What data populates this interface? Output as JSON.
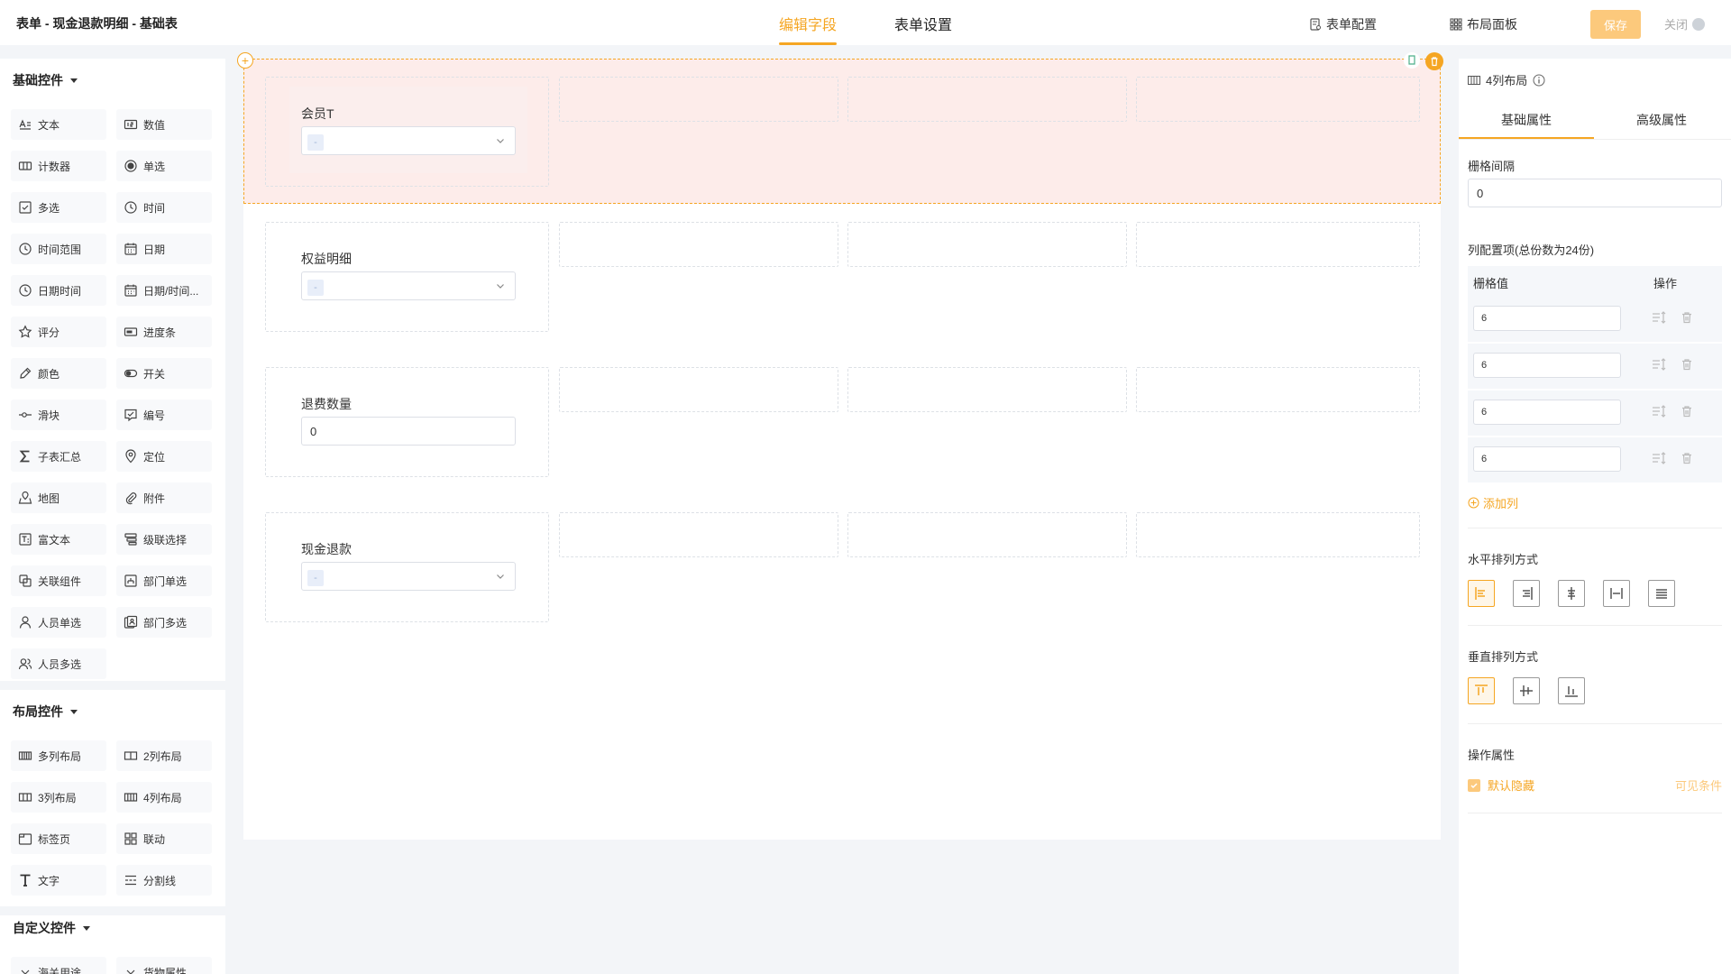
{
  "header": {
    "title": "表单 - 现金退款明细 - 基础表",
    "tabs": [
      {
        "label": "编辑字段",
        "active": true
      },
      {
        "label": "表单设置",
        "active": false
      }
    ],
    "form_config_label": "表单配置",
    "layout_panel_label": "布局面板",
    "save_label": "保存",
    "close_label": "关闭"
  },
  "left_panel": {
    "basic_title": "基础控件",
    "basic_items": [
      {
        "label": "文本",
        "icon": "text-icon"
      },
      {
        "label": "数值",
        "icon": "number-icon"
      },
      {
        "label": "计数器",
        "icon": "counter-icon"
      },
      {
        "label": "单选",
        "icon": "radio-icon"
      },
      {
        "label": "多选",
        "icon": "checkbox-icon"
      },
      {
        "label": "时间",
        "icon": "clock-icon"
      },
      {
        "label": "时间范围",
        "icon": "clock-icon"
      },
      {
        "label": "日期",
        "icon": "calendar-icon"
      },
      {
        "label": "日期时间",
        "icon": "clock-icon"
      },
      {
        "label": "日期/时间...",
        "icon": "calendar-icon"
      },
      {
        "label": "评分",
        "icon": "star-icon"
      },
      {
        "label": "进度条",
        "icon": "progress-icon"
      },
      {
        "label": "颜色",
        "icon": "color-picker-icon"
      },
      {
        "label": "开关",
        "icon": "toggle-icon"
      },
      {
        "label": "滑块",
        "icon": "slider-icon"
      },
      {
        "label": "编号",
        "icon": "serial-icon"
      },
      {
        "label": "子表汇总",
        "icon": "sigma-icon"
      },
      {
        "label": "定位",
        "icon": "location-icon"
      },
      {
        "label": "地图",
        "icon": "map-icon"
      },
      {
        "label": "附件",
        "icon": "attachment-icon"
      },
      {
        "label": "富文本",
        "icon": "richtext-icon"
      },
      {
        "label": "级联选择",
        "icon": "cascade-icon"
      },
      {
        "label": "关联组件",
        "icon": "link-component-icon"
      },
      {
        "label": "部门单选",
        "icon": "department-icon"
      },
      {
        "label": "人员单选",
        "icon": "user-icon"
      },
      {
        "label": "部门多选",
        "icon": "department-multi-icon"
      },
      {
        "label": "人员多选",
        "icon": "users-icon"
      }
    ],
    "layout_title": "布局控件",
    "layout_items": [
      {
        "label": "多列布局",
        "icon": "multi-column-icon"
      },
      {
        "label": "2列布局",
        "icon": "two-column-icon"
      },
      {
        "label": "3列布局",
        "icon": "three-column-icon"
      },
      {
        "label": "4列布局",
        "icon": "four-column-icon"
      },
      {
        "label": "标签页",
        "icon": "tabs-icon"
      },
      {
        "label": "联动",
        "icon": "linkage-icon"
      },
      {
        "label": "文字",
        "icon": "text-t-icon"
      },
      {
        "label": "分割线",
        "icon": "divider-icon"
      }
    ],
    "custom_title": "自定义控件",
    "custom_items": [
      {
        "label": "海关用途",
        "icon": "chevron-down-icon"
      },
      {
        "label": "货物属性",
        "icon": "chevron-down-icon"
      }
    ]
  },
  "canvas": {
    "rows": [
      {
        "label": "会员T",
        "type": "select",
        "selected": true
      },
      {
        "label": "权益明细",
        "type": "select",
        "selected": false
      },
      {
        "label": "退费数量",
        "type": "input",
        "value": "0",
        "selected": false
      },
      {
        "label": "现金退款",
        "type": "select",
        "selected": false
      }
    ],
    "tag_placeholder": "-"
  },
  "right_panel": {
    "title": "4列布局",
    "tabs": [
      {
        "label": "基础属性",
        "active": true
      },
      {
        "label": "高级属性",
        "active": false
      }
    ],
    "gutter_label": "栅格间隔",
    "gutter_value": "0",
    "columns_label": "列配置项(总份数为24份)",
    "col_header_value": "栅格值",
    "col_header_action": "操作",
    "columns": [
      "6",
      "6",
      "6",
      "6"
    ],
    "add_column_label": "添加列",
    "horizontal_label": "水平排列方式",
    "vertical_label": "垂直排列方式",
    "operation_label": "操作属性",
    "default_hidden_label": "默认隐藏",
    "default_hidden_checked": true,
    "visible_condition_label": "可见条件"
  },
  "colors": {
    "accent": "#f5a623",
    "selected_row_bg": "#fdecea"
  }
}
